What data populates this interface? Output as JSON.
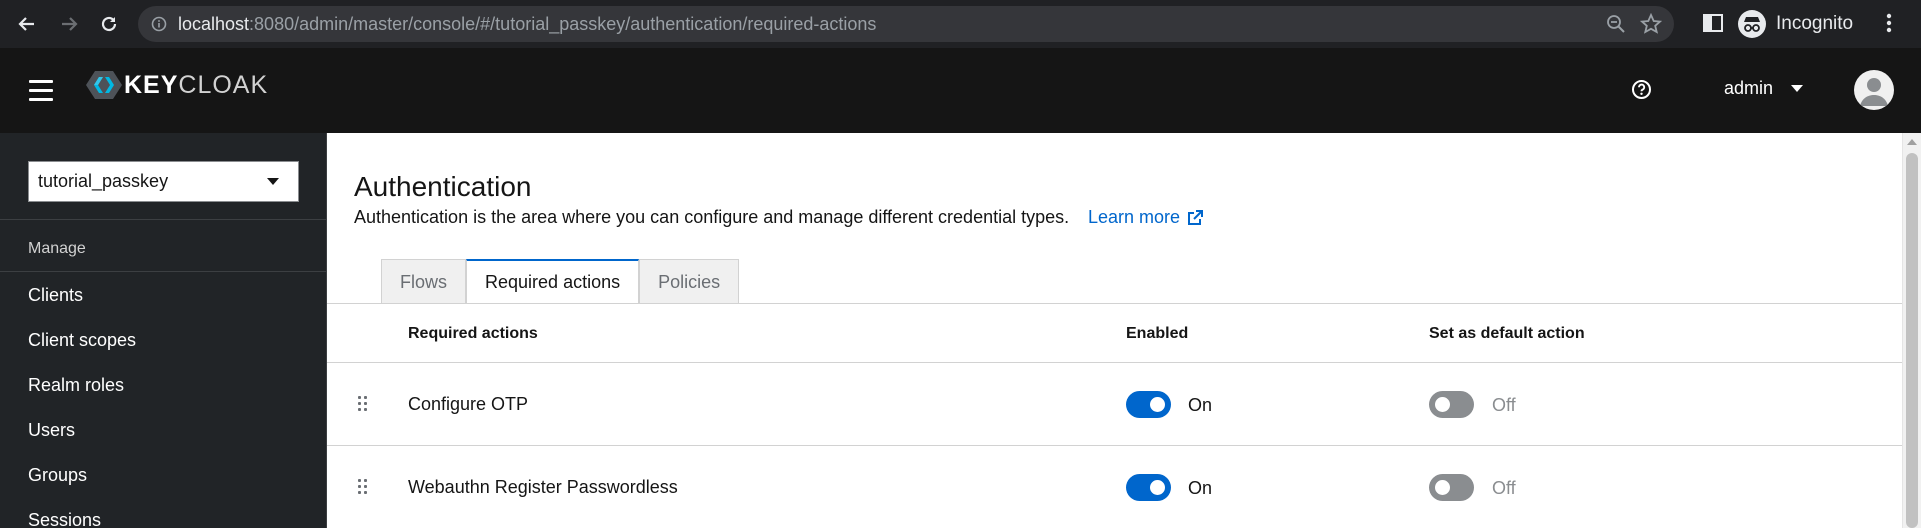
{
  "browser": {
    "url_host": "localhost",
    "url_rest": ":8080/admin/master/console/#/tutorial_passkey/authentication/required-actions",
    "profile_label": "Incognito"
  },
  "masthead": {
    "logo_key": "KEY",
    "logo_cloak": "CLOAK",
    "username": "admin"
  },
  "sidebar": {
    "realm": "tutorial_passkey",
    "section": "Manage",
    "items": [
      "Clients",
      "Client scopes",
      "Realm roles",
      "Users",
      "Groups",
      "Sessions"
    ]
  },
  "page": {
    "title": "Authentication",
    "description": "Authentication is the area where you can configure and manage different credential types.",
    "learn_more": "Learn more"
  },
  "tabs": [
    "Flows",
    "Required actions",
    "Policies"
  ],
  "active_tab": "Required actions",
  "table": {
    "headers": [
      "Required actions",
      "Enabled",
      "Set as default action"
    ],
    "rows": [
      {
        "name": "Configure OTP",
        "enabled": true,
        "enabled_label": "On",
        "default": false,
        "default_label": "Off"
      },
      {
        "name": "Webauthn Register Passwordless",
        "enabled": true,
        "enabled_label": "On",
        "default": false,
        "default_label": "Off"
      }
    ]
  },
  "colors": {
    "accent": "#0066cc",
    "masthead": "#151515",
    "sidebar": "#212427"
  }
}
